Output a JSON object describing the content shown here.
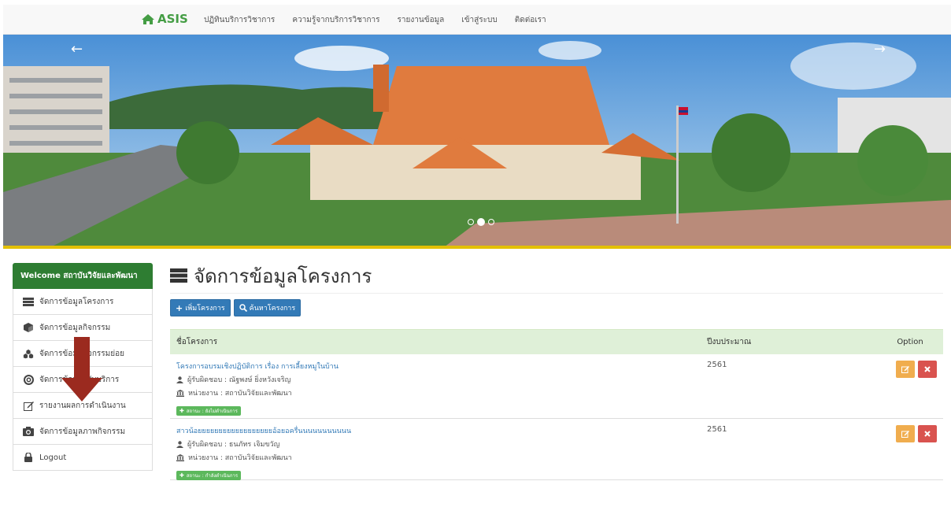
{
  "navbar": {
    "brand": "ASIS",
    "links": [
      "ปฏิทินบริการวิชาการ",
      "ความรู้จากบริการวิชาการ",
      "รายงานข้อมูล",
      "เข้าสู่ระบบ",
      "ติดต่อเรา"
    ]
  },
  "carousel": {
    "prev_icon": "arrow-left-icon",
    "next_icon": "arrow-right-icon",
    "slide_count": 3,
    "active_slide": 2
  },
  "sidebar": {
    "header": "Welcome สถาบันวิจัยและพัฒนา",
    "items": [
      {
        "label": "จัดการข้อมูลโครงการ",
        "icon": "list-icon"
      },
      {
        "label": "จัดการข้อมูลกิจกรรม",
        "icon": "cube-icon"
      },
      {
        "label": "จัดการข้อมูลกิจกรรมย่อย",
        "icon": "cubes-icon"
      },
      {
        "label": "จัดการข้อมูลผู้รับบริการ",
        "icon": "lifebuoy-icon"
      },
      {
        "label": "รายงานผลการดำเนินงาน",
        "icon": "edit-icon"
      },
      {
        "label": "จัดการข้อมูลภาพกิจกรรม",
        "icon": "camera-icon"
      },
      {
        "label": "Logout",
        "icon": "lock-icon"
      }
    ]
  },
  "main": {
    "title": "จัดการข้อมูลโครงการ",
    "add_button": "เพิ่มโครงการ",
    "search_button": "ค้นหาโครงการ",
    "table": {
      "headers": [
        "ชื่อโครงการ",
        "ปีงบประมาณ",
        "Option"
      ],
      "rows": [
        {
          "name": "โครงการอบรมเชิงปฏิบัติการ เรื่อง การเลี้ยงหมูในบ้าน",
          "owner": "ผู้รับผิดชอบ : ณัฐพงษ์ ยิ่งหวังเจริญ",
          "agency": "หน่วยงาน : สถาบันวิจัยและพัฒนา",
          "status": "สถานะ : ยังไม่ดำเนินการ",
          "year": "2561"
        },
        {
          "name": "สาวน้อยยยยยยยยยยยยยยยยยยอ้อยอครื่นนนนนนนนนนน",
          "owner": "ผู้รับผิดชอบ : ธนภัทร เจิมขวัญ",
          "agency": "หน่วยงาน : สถาบันวิจัยและพัฒนา",
          "status": "สถานะ : กำลังดำเนินการ",
          "year": "2561"
        }
      ]
    }
  },
  "colors": {
    "brand_green": "#449d44",
    "sidebar_header": "#2e7d32",
    "primary": "#337ab7",
    "warning": "#f0ad4e",
    "danger": "#d9534f",
    "success": "#5cb85c",
    "annotation_arrow": "#9b2a1f"
  }
}
